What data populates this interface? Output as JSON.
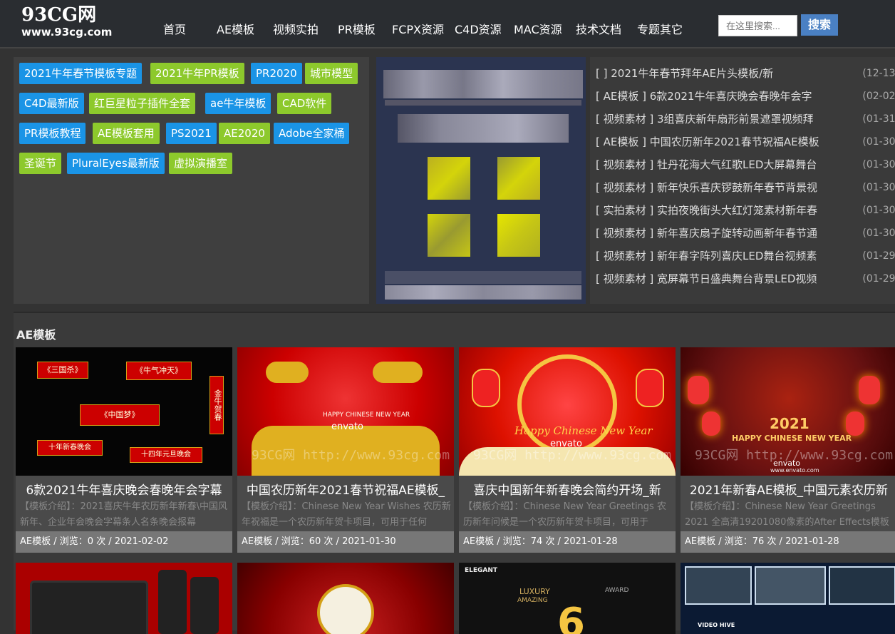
{
  "logo": {
    "title": "93CG网",
    "url": "www.93cg.com"
  },
  "nav": [
    "首页",
    "AE模板",
    "视频实拍",
    "PR模板",
    "FCPX资源",
    "C4D资源",
    "MAC资源",
    "技术文档",
    "专题其它"
  ],
  "search": {
    "placeholder": "在这里搜索...",
    "button": "搜索"
  },
  "tags": [
    {
      "label": "2021牛年春节模板专题",
      "color": "blue"
    },
    {
      "label": "2021牛年PR模板",
      "color": "green"
    },
    {
      "label": "PR2020",
      "color": "blue"
    },
    {
      "label": "城市模型",
      "color": "green"
    },
    {
      "label": "C4D最新版",
      "color": "blue"
    },
    {
      "label": "红巨星粒子插件全套",
      "color": "green"
    },
    {
      "label": "ae牛年模板",
      "color": "blue"
    },
    {
      "label": "CAD软件",
      "color": "green"
    },
    {
      "label": "PR模板教程",
      "color": "blue"
    },
    {
      "label": "AE模板套用",
      "color": "green"
    },
    {
      "label": "PS2021",
      "color": "blue"
    },
    {
      "label": "AE2020",
      "color": "green"
    },
    {
      "label": "Adobe全家桶",
      "color": "blue"
    },
    {
      "label": "圣诞节",
      "color": "green"
    },
    {
      "label": "PluralEyes最新版",
      "color": "blue"
    },
    {
      "label": "虚拟演播室",
      "color": "green"
    }
  ],
  "news": [
    {
      "title": "[ ] 2021牛年春节拜年AE片头模板/新",
      "date": "(12-13)"
    },
    {
      "title": "[ AE模板 ] 6款2021牛年喜庆晚会春晚年会字",
      "date": "(02-02)"
    },
    {
      "title": "[ 视频素材 ] 3组喜庆新年扇形前景遮罩视频拜",
      "date": "(01-31)"
    },
    {
      "title": "[ AE模板 ] 中国农历新年2021春节祝福AE模板",
      "date": "(01-30)"
    },
    {
      "title": "[ 视频素材 ] 牡丹花海大气红歌LED大屏幕舞台",
      "date": "(01-30)"
    },
    {
      "title": "[ 视频素材 ] 新年快乐喜庆锣鼓新年春节背景视",
      "date": "(01-30)"
    },
    {
      "title": "[ 实拍素材 ] 实拍夜晚街头大红灯笼素材新年春",
      "date": "(01-30)"
    },
    {
      "title": "[ 视频素材 ] 新年喜庆扇子旋转动画新年春节通",
      "date": "(01-30)"
    },
    {
      "title": "[ 视频素材 ] 新年春字阵列喜庆LED舞台视频素",
      "date": "(01-29)"
    },
    {
      "title": "[ 视频素材 ] 宽屏幕节日盛典舞台背景LED视频",
      "date": "(01-29)"
    }
  ],
  "section": {
    "title": "AE模板",
    "cards": [
      {
        "title": "6款2021牛年喜庆晚会春晚年会字幕",
        "desc": "【模板介绍】：2021喜庆牛年农历新年新春\\中国风新年、企业年会晚会字幕条人名条晚会报幕",
        "meta": "AE模板 / 浏览：0 次 / 2021-02-02",
        "watermark": "",
        "thumb_text": [
          "《三国杀》",
          "《牛气冲天》",
          "金牛贺春",
          "《中国梦》",
          "十四年元旦晚会",
          "十年新春晚会"
        ]
      },
      {
        "title": "中国农历新年2021春节祝福AE模板_",
        "desc": "【模板介绍】：Chinese New Year Wishes 农历新年祝福是一个农历新年贺卡项目，可用于任何",
        "meta": "AE模板 / 浏览：60 次 / 2021-01-30",
        "watermark": "93CG网 http://www.93cg.com",
        "thumb_text": [
          "HAPPY CHINESE NEW YEAR",
          "envato"
        ]
      },
      {
        "title": "喜庆中国新年新春晚会简约开场_新",
        "desc": "【模板介绍】：Chinese New Year Greetings 农历新年问候是一个农历新年贺卡项目，可用于",
        "meta": "AE模板 / 浏览：74 次 / 2021-01-28",
        "watermark": "93CG网 http://www.93cg.com",
        "thumb_text": [
          "Happy Chinese New Year",
          "envato"
        ]
      },
      {
        "title": "2021年新春AE模板_中国元素农历新",
        "desc": "【模板介绍】：Chinese New Year Greetings 2021 全高清19201080像素的After Effects模板",
        "meta": "AE模板 / 浏览：76 次 / 2021-01-28",
        "watermark": "93CG网 http://www.93cg.com",
        "thumb_text": [
          "2021",
          "HAPPY CHINESE NEW YEAR",
          "envato",
          "www.envato.com"
        ]
      }
    ],
    "cards_row2_text": [
      "ELEGANT",
      "LUXURY",
      "AMAZING",
      "AWARD",
      "6",
      "VIDEO HIVE"
    ]
  },
  "colors": {
    "blue_tag": "#1a94e6",
    "green_tag": "#8dc92c",
    "search_button": "#4a80c3",
    "header_bg": "#2a2d31"
  }
}
